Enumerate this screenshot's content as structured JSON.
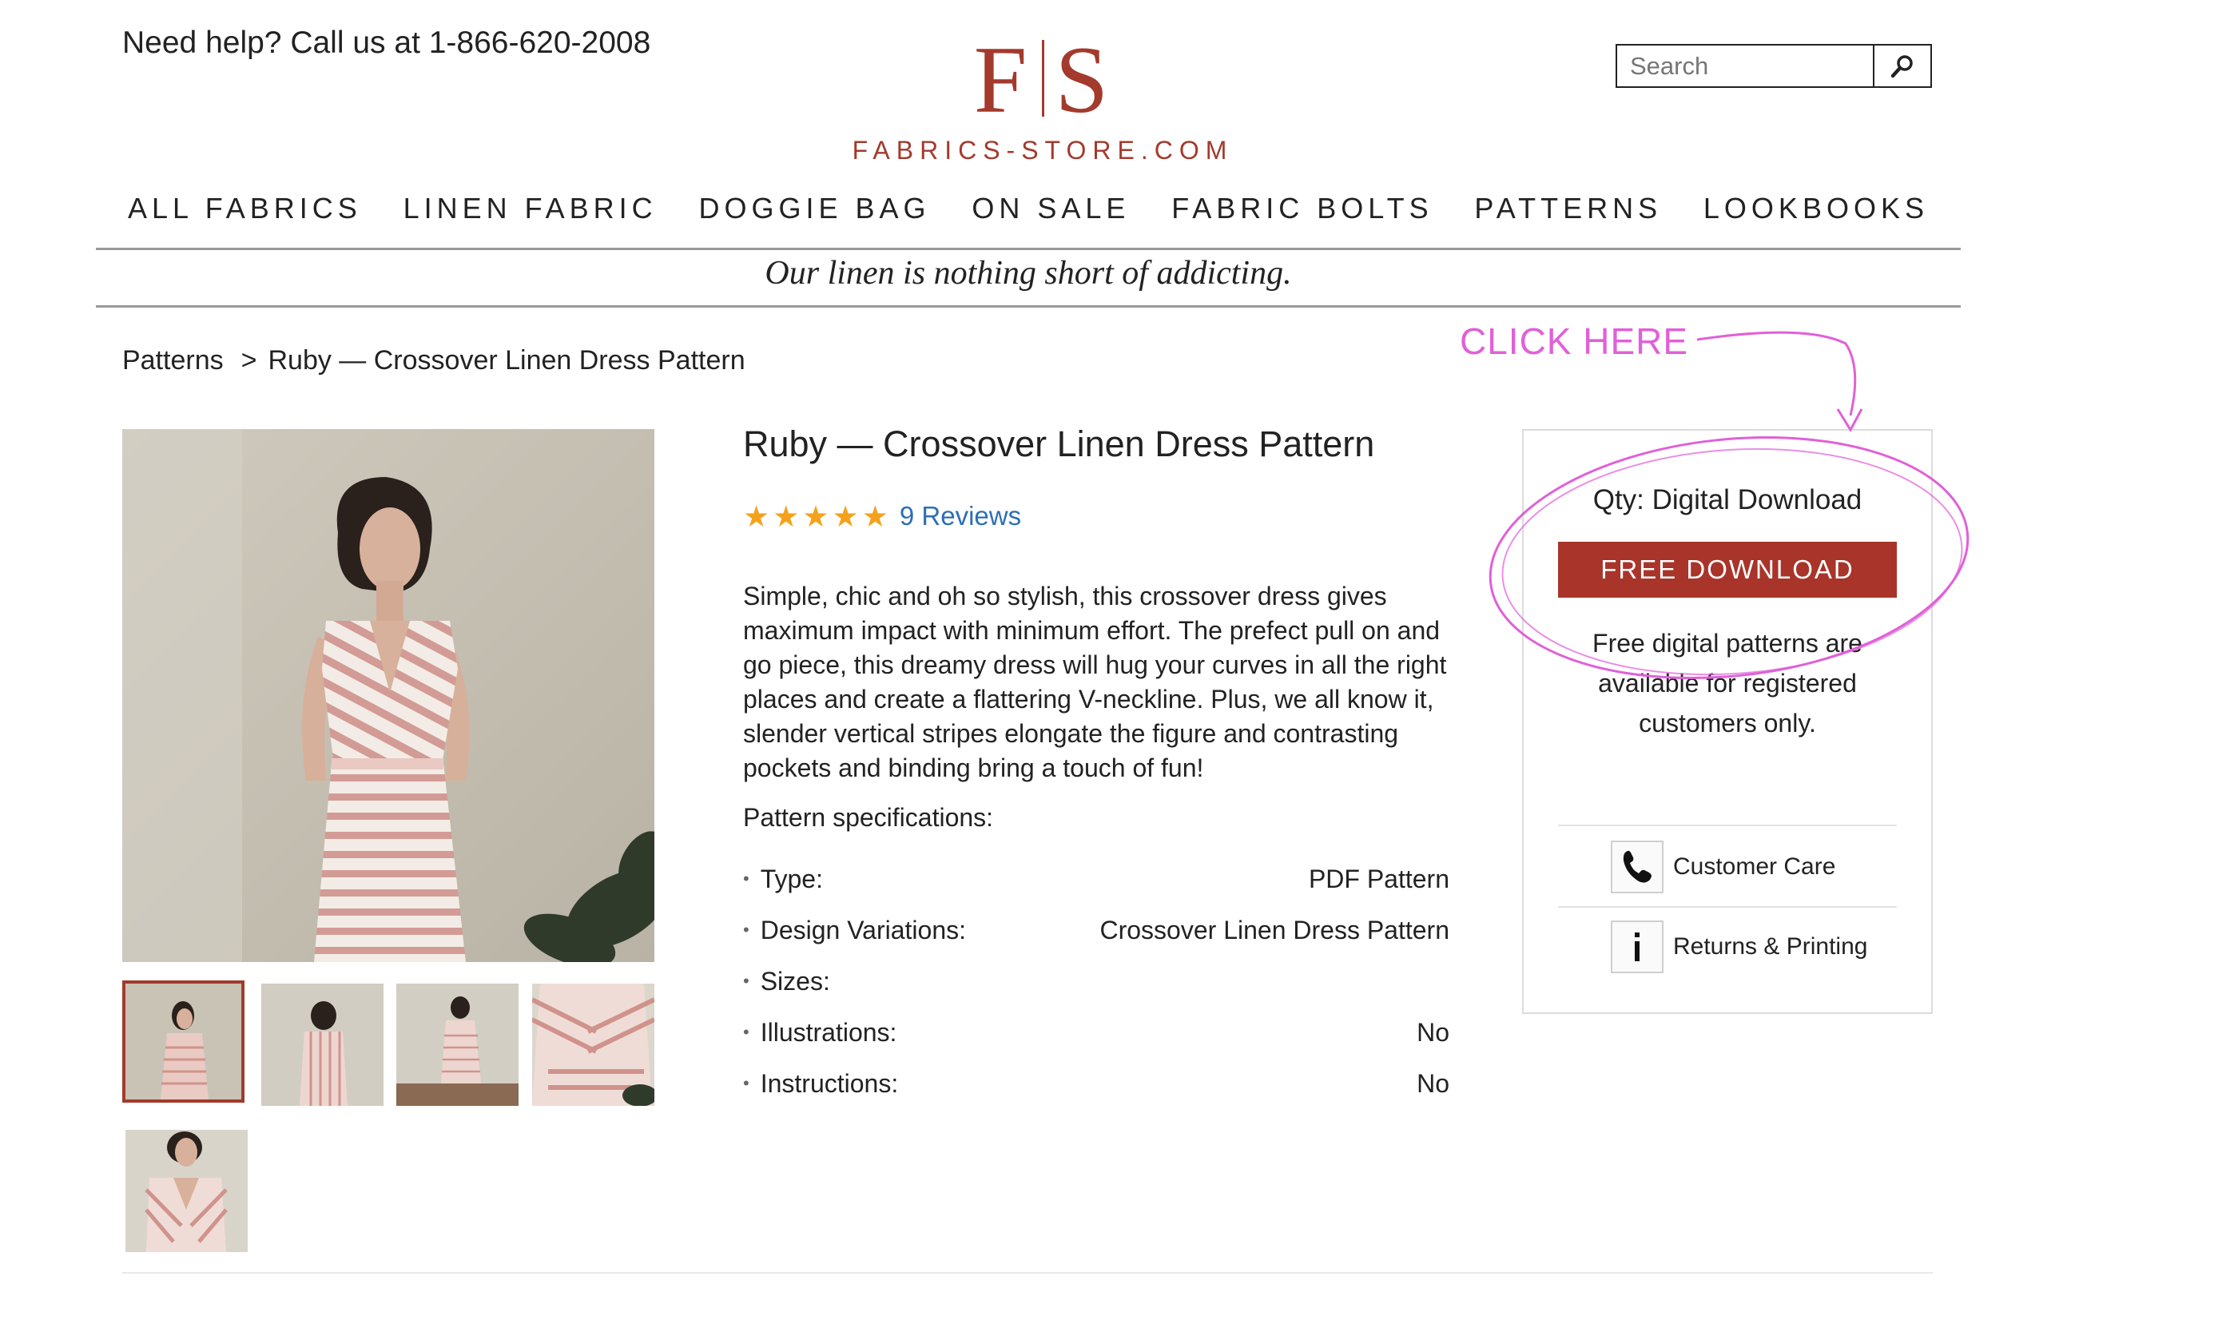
{
  "header": {
    "help_text": "Need help? Call us at 1-866-620-2008",
    "logo": {
      "letters": "F S",
      "name": "FABRICS-STORE.COM"
    },
    "search": {
      "placeholder": "Search"
    }
  },
  "nav": {
    "items": [
      {
        "label": "ALL FABRICS"
      },
      {
        "label": "LINEN FABRIC"
      },
      {
        "label": "DOGGIE BAG"
      },
      {
        "label": "ON SALE"
      },
      {
        "label": "FABRIC BOLTS"
      },
      {
        "label": "PATTERNS"
      },
      {
        "label": "LOOKBOOKS"
      }
    ],
    "tagline": "Our linen is nothing short of addicting."
  },
  "breadcrumb": {
    "items": [
      "Patterns",
      "Ruby — Crossover Linen Dress Pattern"
    ],
    "separator": ">"
  },
  "product": {
    "title": "Ruby — Crossover Linen Dress Pattern",
    "rating": {
      "stars": 5,
      "reviews_label": "9 Reviews"
    },
    "description": "Simple, chic and oh so stylish, this crossover dress gives maximum impact with minimum effort. The prefect pull on and go piece, this dreamy dress will hug your curves in all the right places and create a flattering V-neckline. Plus, we all know it, slender vertical stripes elongate the figure and contrasting pockets and binding bring a touch of fun!",
    "spec_heading": "Pattern specifications:",
    "specs": [
      {
        "key": "Type:",
        "value": "PDF Pattern"
      },
      {
        "key": "Design Variations:",
        "value": "Crossover Linen Dress Pattern"
      },
      {
        "key": "Sizes:",
        "value": ""
      },
      {
        "key": "Illustrations:",
        "value": "No"
      },
      {
        "key": "Instructions:",
        "value": "No"
      }
    ],
    "thumbnails_count": 5,
    "selected_thumbnail": 1
  },
  "purchase": {
    "qty_label": "Qty: Digital Download",
    "button_label": "FREE DOWNLOAD",
    "note": "Free digital patterns are available for registered customers only.",
    "links": [
      {
        "label": "Customer Care",
        "icon": "phone-icon"
      },
      {
        "label": "Returns & Printing",
        "icon": "info-icon"
      }
    ]
  },
  "annotation": {
    "callout": "CLICK HERE",
    "color": "#e060d8"
  },
  "colors": {
    "brand": "#a33a2c",
    "button": "#a8342a",
    "link": "#2d6fb3",
    "star": "#f4a21c"
  }
}
